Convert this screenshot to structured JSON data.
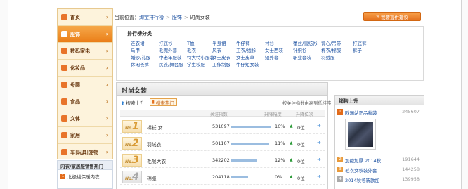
{
  "sidebar": {
    "items": [
      {
        "label": "首页",
        "icon": "home-icon",
        "color": "#e8742a",
        "active": false
      },
      {
        "label": "服饰",
        "icon": "clothing-icon",
        "color": "#ffffff",
        "active": true
      },
      {
        "label": "数码家电",
        "icon": "digital-icon",
        "color": "#e8742a",
        "active": false
      },
      {
        "label": "化妆品",
        "icon": "cosmetics-icon",
        "color": "#e8742a",
        "active": false
      },
      {
        "label": "母婴",
        "icon": "baby-icon",
        "color": "#e8742a",
        "active": false
      },
      {
        "label": "食品",
        "icon": "food-icon",
        "color": "#e8742a",
        "active": false
      },
      {
        "label": "文体",
        "icon": "sports-icon",
        "color": "#e8742a",
        "active": false
      },
      {
        "label": "家居",
        "icon": "home-furnishing-icon",
        "color": "#e8742a",
        "active": false
      },
      {
        "label": "车|玩具|宠物",
        "icon": "car-icon",
        "color": "#e8742a",
        "active": false
      }
    ],
    "hot_title": "内衣/家居服销售热门",
    "hot_items": [
      {
        "rank": "1",
        "label": "北极绒保暖内衣"
      }
    ]
  },
  "breadcrumb": {
    "prefix": "当前位置：",
    "crumbs": [
      "淘宝排行榜",
      "服饰",
      "时尚女装"
    ],
    "sep": ">"
  },
  "feedback_label": "我要提供建议",
  "rank_categories": {
    "title": "排行榜分类",
    "rows": [
      [
        "连衣裙",
        "打底衫",
        "T恤",
        "半身裙",
        "牛仔裤",
        "衬衫",
        "蕾丝/雪纺衫",
        "背心/吊带",
        "打底裤"
      ],
      [
        "马甲",
        "毛呢外套",
        "毛衣",
        "风衣",
        "卫衣/绒衫",
        "女士西装",
        "针织衫",
        "棉衣/棉服",
        "裤子"
      ],
      [
        "婚纱/礼服",
        "中老年服装",
        "特大特小服装",
        "女士皮衣",
        "女士皮草",
        "短外套",
        "职业套装",
        "羽绒服"
      ],
      [
        "休闲长裤",
        "民族/舞台服",
        "学生校服",
        "工作制服",
        "牛仔短女装"
      ]
    ]
  },
  "main": {
    "title": "时尚女装",
    "sort_up": "搜索上升",
    "sort_hot": "搜索热门",
    "note": "按关注指数由高到低排序",
    "columns": [
      "关注指数",
      "升降幅度",
      "升降位次"
    ],
    "rows": [
      {
        "rank": "1",
        "keyword": "棉袄 女",
        "index": "531097",
        "change": "16%",
        "rank_change": "0位",
        "bar": 0.95
      },
      {
        "rank": "2",
        "keyword": "羽绒衣",
        "index": "501107",
        "change": "11%",
        "rank_change": "0位",
        "bar": 0.9
      },
      {
        "rank": "3",
        "keyword": "毛呢大衣",
        "index": "342202",
        "change": "12%",
        "rank_change": "0位",
        "bar": 0.62
      },
      {
        "rank": "4",
        "keyword": "棉服",
        "index": "204118",
        "change": "0%",
        "rank_change": "0位",
        "bar": 0.4
      }
    ]
  },
  "sales": {
    "title": "销售上升",
    "items": [
      {
        "rank": "1",
        "name": "欧洲站正品秋装",
        "value": "245607",
        "color": "#e26b1a"
      },
      {
        "rank": "2",
        "name": "加绒加厚 2014秋",
        "value": "191644",
        "color": "#e99a3a"
      },
      {
        "rank": "3",
        "name": "毛衣女秋装外套",
        "value": "144258",
        "color": "#e99a3a"
      },
      {
        "rank": "4",
        "name": "2014秋冬新款加",
        "value": "139958",
        "color": "#aaaaaa"
      }
    ]
  }
}
